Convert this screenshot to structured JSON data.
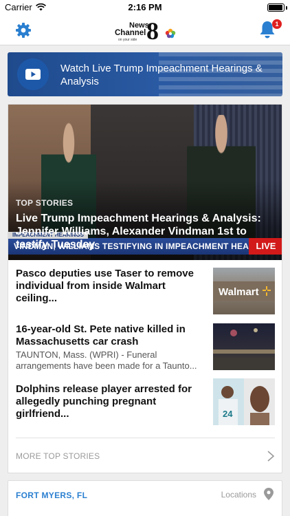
{
  "status_bar": {
    "carrier": "Carrier",
    "time": "2:16 PM",
    "battery_level": 0.95
  },
  "nav": {
    "settings_icon": "gear-icon",
    "logo_line1": "News",
    "logo_line2": "Channel",
    "logo_number": "8",
    "logo_tagline": "on your side",
    "notifications_icon": "bell-icon",
    "notification_count": "1",
    "accent_color": "#2a7fd0"
  },
  "banner": {
    "icon": "play-icon",
    "text": "Watch Live Trump Impeachment Hearings & Analysis"
  },
  "top_stories": {
    "hero": {
      "kicker": "TOP STORIES",
      "title": "Live Trump Impeachment Hearings & Analysis: Jennifer Williams, Alexander Vindman 1st to testify Tuesday",
      "ticker_tag": "IMPEACHMENT HEARINGS",
      "ticker_text": "VINDMAN, WILLIAMS TESTIFYING IN IMPEACHMENT HEARINGS",
      "ticker_live": "LIVE"
    },
    "stories": [
      {
        "title": "Pasco deputies use Taser to remove individual from inside Walmart ceiling...",
        "subtitle": "",
        "thumb_text": "Walmart"
      },
      {
        "title": "16-year-old St. Pete native killed in Massachusetts car crash",
        "subtitle": "TAUNTON, Mass. (WPRI) - Funeral arrangements have been made for a Taunto...",
        "thumb_text": ""
      },
      {
        "title": "Dolphins release player arrested for allegedly punching pregnant girlfriend...",
        "subtitle": "",
        "thumb_text": "24"
      }
    ],
    "more_label": "MORE TOP STORIES"
  },
  "location": {
    "city": "FORT MYERS, FL",
    "link_label": "Locations",
    "icon": "location-pin-icon"
  }
}
